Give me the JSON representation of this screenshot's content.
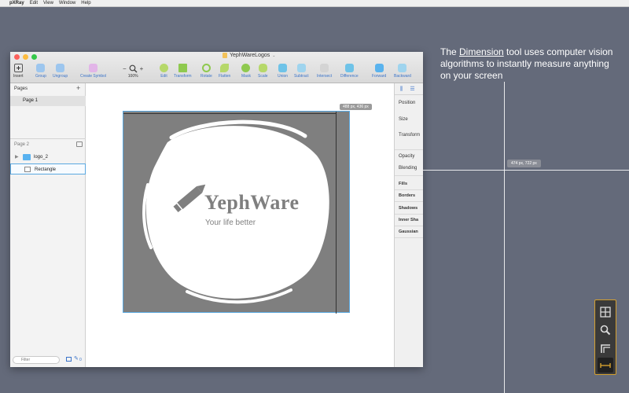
{
  "menubar": {
    "apple": "",
    "items": [
      "pXRay",
      "Edit",
      "View",
      "Window",
      "Help"
    ]
  },
  "window": {
    "title": "YephWareLogos",
    "toolbar": {
      "insert": "Insert",
      "group": "Group",
      "ungroup": "Ungroup",
      "create_symbol": "Create Symbol",
      "zoom_minus": "−",
      "zoom_plus": "+",
      "zoom_value": "100%",
      "edit": "Edit",
      "transform": "Transform",
      "rotate": "Rotate",
      "flatten": "Flatten",
      "mask": "Mask",
      "scale": "Scale",
      "union": "Union",
      "subtract": "Subtract",
      "intersect": "Intersect",
      "difference": "Difference",
      "forward": "Forward",
      "backward": "Backward"
    },
    "sidebar": {
      "pages_header": "Pages",
      "pages": [
        "Page 1",
        "Page 2"
      ],
      "layers": [
        "logo_2",
        "Rectangle"
      ],
      "filter_placeholder": "Filter",
      "badge_count": "0"
    },
    "canvas": {
      "logo_title": "YephWare",
      "logo_tagline": "Your life better",
      "measure_label": "488 px, 436 px"
    },
    "inspector": {
      "position": "Position",
      "size": "Size",
      "transform": "Transform",
      "opacity": "Opacity",
      "blending": "Blending",
      "fills": "Fills",
      "borders": "Borders",
      "shadows": "Shadows",
      "inner_shadows": "Inner Sha",
      "gaussian": "Gaussian"
    }
  },
  "description": {
    "before": "The ",
    "tool": "Dimension",
    "after": " tool uses computer vision algorithms to instantly measure anything on your screen"
  },
  "crosshair": {
    "label": "474 px, 722 px"
  },
  "palette": {
    "tools": [
      "grid-icon",
      "magnifier-icon",
      "corner-icon",
      "dimension-icon"
    ],
    "accent": "#d4a02f"
  }
}
